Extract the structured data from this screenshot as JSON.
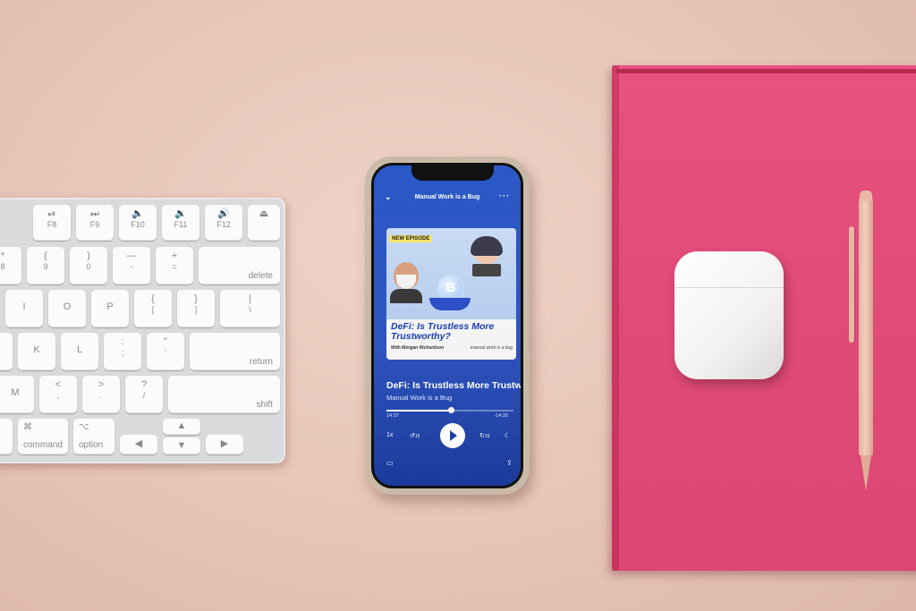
{
  "keyboard": {
    "fn_row": [
      "F8",
      "F9",
      "F10",
      "F11",
      "F12"
    ],
    "number_row": [
      {
        "top": "*",
        "bottom": "8"
      },
      {
        "top": "(",
        "bottom": "9"
      },
      {
        "top": ")",
        "bottom": "0"
      },
      {
        "top": "—",
        "bottom": "-"
      },
      {
        "top": "+",
        "bottom": "="
      }
    ],
    "delete": "delete",
    "row_qwerty": [
      "I",
      "O",
      "P"
    ],
    "brackets": [
      {
        "top": "{",
        "bottom": "["
      },
      {
        "top": "}",
        "bottom": "]"
      },
      {
        "top": "|",
        "bottom": "\\"
      }
    ],
    "row_home": [
      "J",
      "K",
      "L"
    ],
    "semicolon": {
      "top": ":",
      "bottom": ";"
    },
    "quote": {
      "top": "\"",
      "bottom": "'"
    },
    "return": "return",
    "row_bottom": [
      "M"
    ],
    "comma": {
      "top": "<",
      "bottom": ","
    },
    "period": {
      "top": ">",
      "bottom": "."
    },
    "slash": {
      "top": "?",
      "bottom": "/"
    },
    "shift": "shift",
    "command": {
      "symbol": "⌘",
      "label": "command"
    },
    "option": {
      "symbol": "⌥",
      "label": "option"
    }
  },
  "player": {
    "header_title": "Manual Work is a Bug",
    "artwork": {
      "badge": "NEW EPISODE",
      "title": "DeFi: Is Trustless More Trustworthy?",
      "with": "With Morgan Richardson",
      "logo": "manual work is a bug"
    },
    "episode_title": "DeFi: Is Trustless More Trustworthy?",
    "show_name": "Manual Work is a Bug",
    "elapsed": "14:37",
    "remaining": "-14:20",
    "progress": 0.51,
    "speed": "1x",
    "skip_back": "15",
    "skip_forward": "15"
  },
  "colors": {
    "player_bg": "#2a58c6",
    "notebook": "#e04b79",
    "desk": "#e9c8bc"
  },
  "icons": [
    "chevron-down-icon",
    "more-icon",
    "skip-back-icon",
    "play-icon",
    "skip-forward-icon",
    "sleep-timer-icon",
    "devices-icon",
    "share-icon"
  ]
}
